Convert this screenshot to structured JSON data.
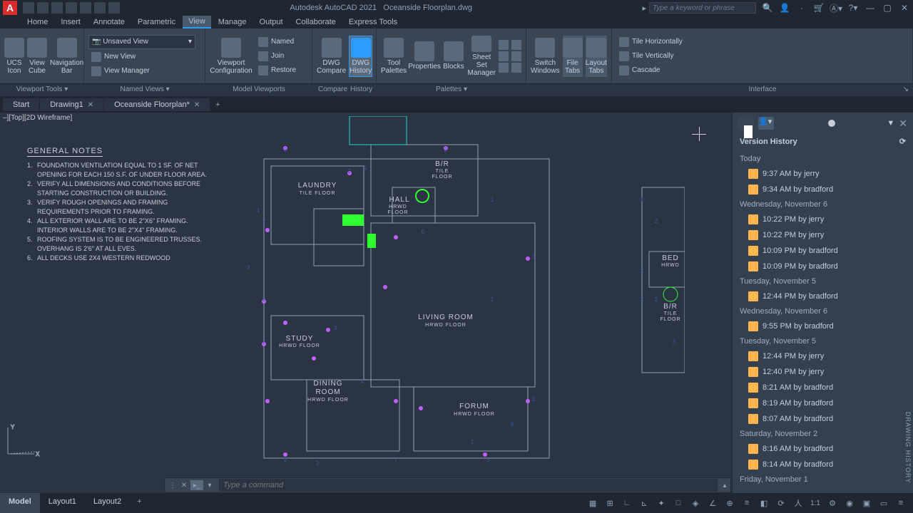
{
  "app": {
    "name": "Autodesk AutoCAD 2021",
    "doc": "Oceanside Floorplan.dwg"
  },
  "search": {
    "placeholder": "Type a keyword or phrase"
  },
  "menu": {
    "tabs": [
      "Home",
      "Insert",
      "Annotate",
      "Parametric",
      "View",
      "Manage",
      "Output",
      "Collaborate",
      "Express Tools"
    ],
    "active": 4
  },
  "ribbon": {
    "viewportTools": {
      "ucs": "UCS\nIcon",
      "cube": "View\nCube",
      "bar": "Navigation\nBar",
      "label": "Viewport Tools ▾"
    },
    "namedViews": {
      "combo": "Unsaved View",
      "new": "New View",
      "mgr": "View Manager",
      "label": "Named Views ▾"
    },
    "modelVp": {
      "cfg": "Viewport\nConfiguration",
      "named": "Named",
      "join": "Join",
      "restore": "Restore",
      "label": "Model Viewports"
    },
    "history": {
      "cmp": "DWG\nCompare",
      "hist": "DWG\nHistory",
      "label1": "Compare",
      "label2": "History"
    },
    "palettes": {
      "tool": "Tool\nPalettes",
      "prop": "Properties",
      "blocks": "Blocks",
      "sheet": "Sheet Set\nManager",
      "label": "Palettes ▾"
    },
    "windows": {
      "switch": "Switch\nWindows",
      "file": "File\nTabs",
      "layout": "Layout\nTabs"
    },
    "interface": {
      "th": "Tile Horizontally",
      "tv": "Tile Vertically",
      "cas": "Cascade",
      "label": "Interface"
    }
  },
  "filetabs": [
    {
      "label": "Start"
    },
    {
      "label": "Drawing1",
      "close": true
    },
    {
      "label": "Oceanside Floorplan*",
      "close": true
    }
  ],
  "viewlabel": "–][Top][2D Wireframe]",
  "notes": {
    "title": "GENERAL NOTES",
    "items": [
      "FOUNDATION VENTILATION EQUAL TO 1 SF. OF NET OPENING FOR EACH 150 S.F. OF UNDER FLOOR AREA.",
      "VERIFY ALL DIMENSIONS AND CONDITIONS BEFORE STARTING CONSTRUCTION OR BUILDING.",
      "VERIFY ROUGH OPENINGS AND FRAMING REQUIREMENTS PRIOR TO FRAMING.",
      "ALL EXTERIOR WALL ARE TO BE 2\"X6\" FRAMING. INTERIOR WALLS ARE TO BE 2\"X4\" FRAMING.",
      "ROOFING SYSTEM IS TO BE ENGINEERED TRUSSES. OVERHANG IS 2'6\" AT ALL EVES.",
      "ALL DECKS USE 2X4 WESTERN REDWOOD"
    ]
  },
  "rooms": {
    "laundry": {
      "name": "LAUNDRY",
      "sub": "TILE  FLOOR"
    },
    "br": {
      "name": "B/R",
      "sub": "TILE\nFLOOR"
    },
    "hall": {
      "name": "HALL",
      "sub": "HRWD\nFLOOR"
    },
    "living": {
      "name": "LIVING  ROOM",
      "sub": "HRWD  FLOOR"
    },
    "study": {
      "name": "STUDY",
      "sub": "HRWD  FLOOR"
    },
    "dining": {
      "name": "DINING\nROOM",
      "sub": "HRWD  FLOOR"
    },
    "forum": {
      "name": "FORUM",
      "sub": "HRWD  FLOOR"
    },
    "bed": {
      "name": "BED",
      "sub": "HRWD"
    },
    "br2": {
      "name": "B/R",
      "sub": "TILE\nFLOOR"
    }
  },
  "versionHistory": {
    "title": "Version History",
    "groups": [
      {
        "label": "Today",
        "items": [
          "9:37 AM by jerry",
          "9:34 AM by bradford"
        ]
      },
      {
        "label": "Wednesday, November 6",
        "items": [
          "10:22 PM by jerry",
          "10:22 PM by jerry",
          "10:09 PM by bradford",
          "10:09 PM by bradford"
        ]
      },
      {
        "label": "Tuesday, November 5",
        "items": [
          "12:44 PM by bradford"
        ]
      },
      {
        "label": "Wednesday, November 6",
        "items": [
          "9:55 PM by bradford"
        ]
      },
      {
        "label": "Tuesday, November 5",
        "items": [
          "12:44 PM by jerry",
          "12:40 PM by jerry",
          "8:21 AM by bradford",
          "8:19 AM by bradford",
          "8:07 AM by bradford"
        ]
      },
      {
        "label": "Saturday, November 2",
        "items": [
          "8:16 AM by bradford",
          "8:14 AM by bradford"
        ]
      },
      {
        "label": "Friday, November 1",
        "items": []
      }
    ]
  },
  "dhlabel": "DRAWING HISTORY",
  "cmd": {
    "placeholder": "Type a command"
  },
  "modeltabs": {
    "items": [
      "Model",
      "Layout1",
      "Layout2"
    ],
    "active": 0
  },
  "status": {
    "scale": "1:1"
  }
}
